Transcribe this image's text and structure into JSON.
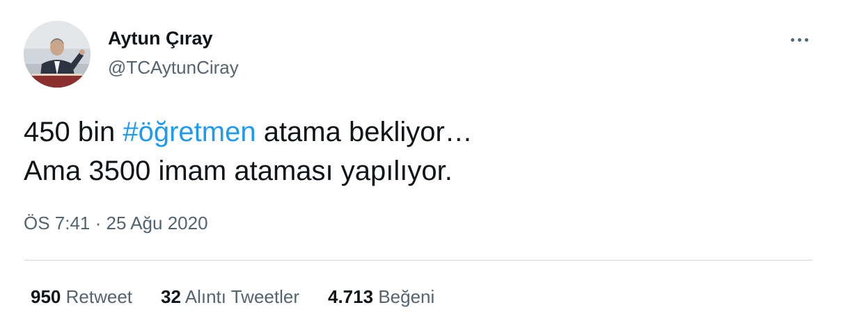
{
  "author": {
    "name": "Aytun Çıray",
    "handle": "@TCAytunCiray"
  },
  "tweet": {
    "line1_before": "450 bin ",
    "hashtag": "#öğretmen",
    "line1_after": " atama bekliyor…",
    "line2": "Ama 3500 imam ataması yapılıyor."
  },
  "timestamp": "ÖS 7:41 · 25 Ağu 2020",
  "stats": {
    "retweets_count": "950",
    "retweets_label": "Retweet",
    "quotes_count": "32",
    "quotes_label": "Alıntı Tweetler",
    "likes_count": "4.713",
    "likes_label": "Beğeni"
  },
  "colors": {
    "hashtag": "#1d9bf0",
    "secondary_text": "#536471",
    "primary_text": "#0f1419",
    "divider": "#cfd9de"
  },
  "icons": {
    "more": "more-horizontal-icon"
  }
}
